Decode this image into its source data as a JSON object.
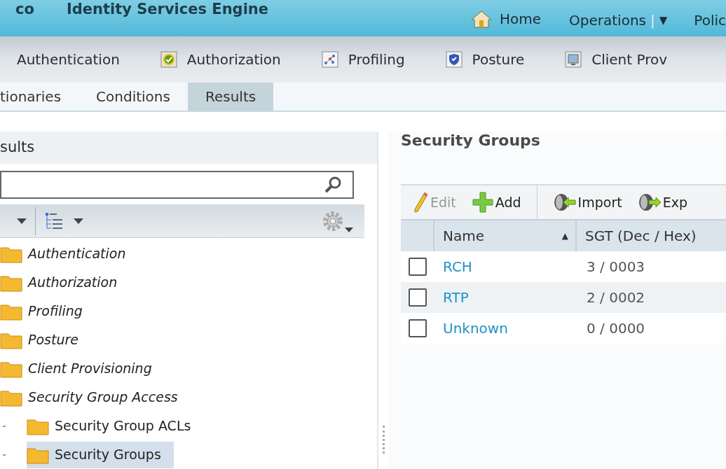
{
  "header": {
    "brand_fragment": "co",
    "title": "Identity Services Engine",
    "nav": [
      {
        "kind": "home",
        "label": "Home"
      },
      {
        "kind": "menu",
        "label": "Operations",
        "separator": "|",
        "caret": "▼"
      },
      {
        "kind": "plain",
        "label": "Polic"
      }
    ]
  },
  "main_tabs": [
    {
      "label": "Authentication",
      "kind": "plain"
    },
    {
      "label": "Authorization",
      "kind": "authorization"
    },
    {
      "label": "Profiling",
      "kind": "profiling"
    },
    {
      "label": "Posture",
      "kind": "posture"
    },
    {
      "label": "Client Prov",
      "kind": "provisioning"
    }
  ],
  "sub_tabs": [
    {
      "label": "tionaries",
      "selected": false
    },
    {
      "label": "Conditions",
      "selected": false
    },
    {
      "label": "Results",
      "selected": true
    }
  ],
  "left_panel": {
    "title": "sults",
    "tree": [
      {
        "label": "Authentication",
        "italic": true,
        "selected": false
      },
      {
        "label": "Authorization",
        "italic": true,
        "selected": false
      },
      {
        "label": "Profiling",
        "italic": true,
        "selected": false
      },
      {
        "label": "Posture",
        "italic": true,
        "selected": false
      },
      {
        "label": "Client Provisioning",
        "italic": true,
        "selected": false
      },
      {
        "label": "Security Group Access",
        "italic": true,
        "selected": false,
        "children": [
          {
            "label": "Security Group ACLs",
            "italic": false,
            "selected": false
          },
          {
            "label": "Security Groups",
            "italic": false,
            "selected": true
          }
        ]
      }
    ]
  },
  "content": {
    "title": "Security Groups",
    "toolbar": [
      {
        "kind": "edit",
        "label": "Edit",
        "disabled": true
      },
      {
        "kind": "add",
        "label": "Add",
        "disabled": false
      },
      {
        "kind": "import",
        "label": "Import",
        "disabled": false
      },
      {
        "kind": "export",
        "label": "Exp",
        "disabled": false
      }
    ],
    "table": {
      "columns": [
        {
          "label": "Name",
          "sort_indicator": "▲"
        },
        {
          "label": "SGT (Dec / Hex)"
        }
      ],
      "rows": [
        {
          "name": "RCH",
          "sgt": "3 / 0003",
          "checked": false
        },
        {
          "name": "RTP",
          "sgt": "2 / 0002",
          "checked": false
        },
        {
          "name": "Unknown",
          "sgt": "0 / 0000",
          "checked": false
        }
      ]
    }
  }
}
